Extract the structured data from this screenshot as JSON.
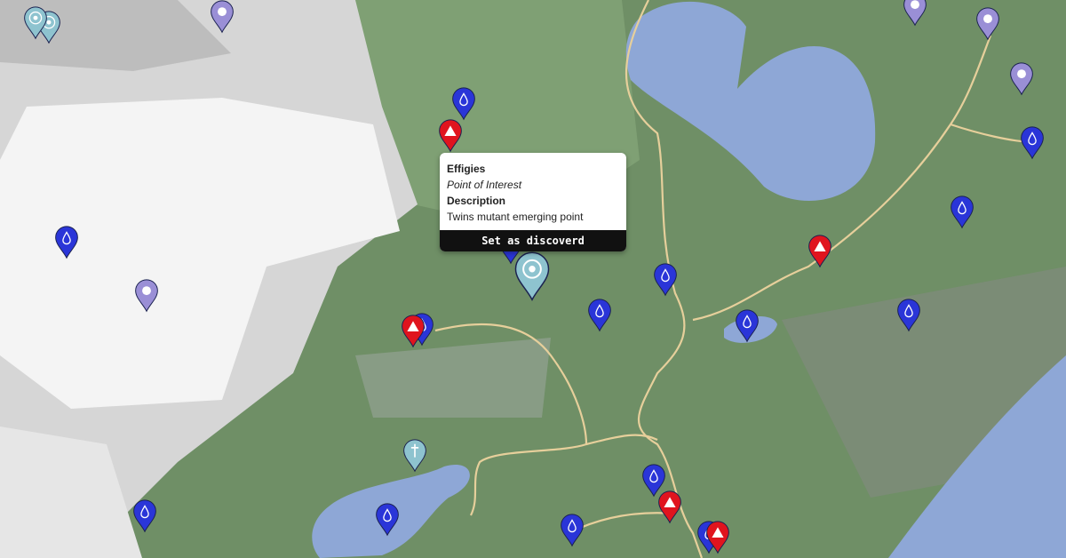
{
  "popup": {
    "title": "Effigies",
    "type": "Point of Interest",
    "description_label": "Description",
    "description": "Twins mutant emerging point",
    "button": "Set as discoverd"
  },
  "colors": {
    "water_marker": "#2a35d8",
    "camp_marker": "#e0141e",
    "poi_marker": "#8ec3cf",
    "lake": "#8ea7d6",
    "terrain": "#6f8f66",
    "road": "#e6cf9b"
  },
  "markers": [
    {
      "name": "water-marker",
      "icon": "drop-icon"
    },
    {
      "name": "camp-marker",
      "icon": "tent-icon"
    },
    {
      "name": "poi-marker",
      "icon": "target-icon"
    },
    {
      "name": "grave-marker",
      "icon": "cross-icon"
    }
  ]
}
